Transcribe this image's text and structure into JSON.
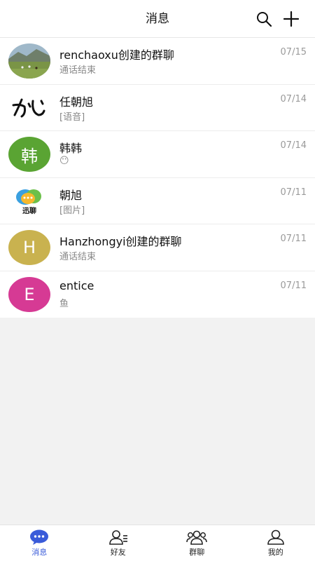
{
  "header": {
    "title": "消息",
    "search_icon": "search-icon",
    "add_icon": "plus-icon"
  },
  "conversations": [
    {
      "name": "renchaoxu创建的群聊",
      "preview": "通话结束",
      "time": "07/15",
      "avatar": "landscape-photo"
    },
    {
      "name": "任朝旭",
      "preview": "[语音]",
      "time": "07/14",
      "avatar": "calligraphy-logo"
    },
    {
      "name": "韩韩",
      "preview": "😶",
      "time": "07/14",
      "avatar_text": "韩",
      "avatar_color": "#5aa433"
    },
    {
      "name": "朝旭",
      "preview": "[图片]",
      "time": "07/11",
      "avatar": "xunliao-logo",
      "avatar_caption": "迅聊"
    },
    {
      "name": "Hanzhongyi创建的群聊",
      "preview": "通话结束",
      "time": "07/11",
      "avatar_text": "H",
      "avatar_color": "#c9b24f"
    },
    {
      "name": "entice",
      "preview": "鱼",
      "time": "07/11",
      "avatar_text": "E",
      "avatar_color": "#d63a94"
    }
  ],
  "tabbar": {
    "tabs": [
      {
        "label": "消息",
        "icon": "chat-bubble-icon",
        "active": true
      },
      {
        "label": "好友",
        "icon": "friends-icon",
        "active": false
      },
      {
        "label": "群聊",
        "icon": "group-icon",
        "active": false
      },
      {
        "label": "我的",
        "icon": "profile-icon",
        "active": false
      }
    ],
    "accent": "#3a5bd9"
  }
}
